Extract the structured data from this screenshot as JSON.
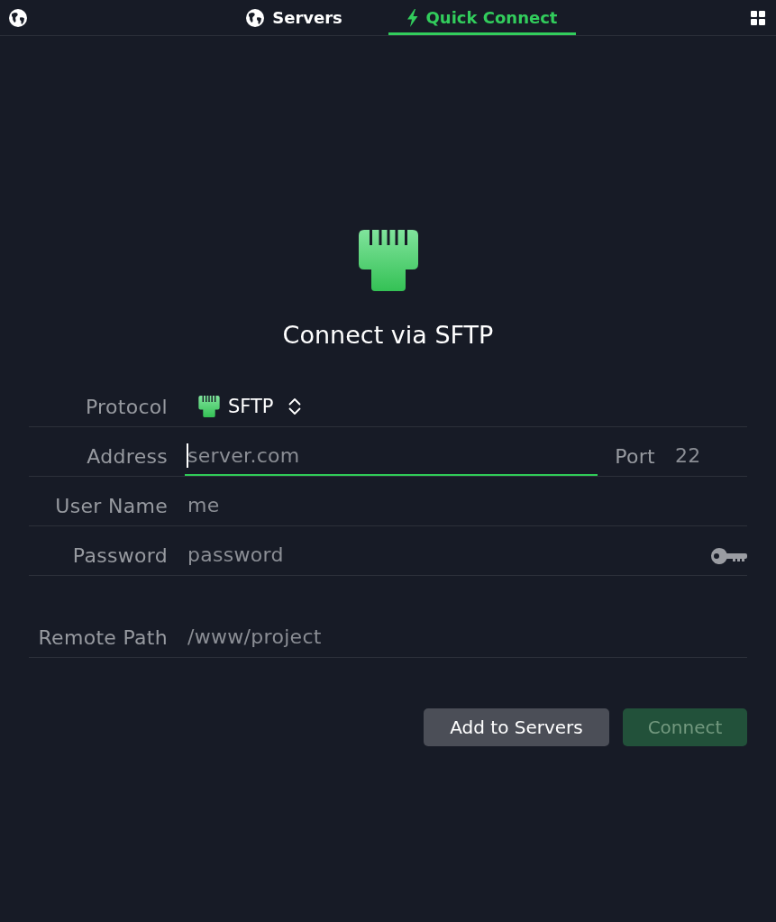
{
  "top_bar": {
    "tabs": [
      {
        "label": "Servers",
        "selected": false
      },
      {
        "label": "Quick Connect",
        "selected": true
      }
    ]
  },
  "heading": "Connect via SFTP",
  "form": {
    "rows": [
      {
        "kind": "select",
        "label": "Protocol",
        "value": "SFTP"
      },
      {
        "kind": "address",
        "label": "Address",
        "placeholder": "server.com",
        "focused": true,
        "port_label": "Port",
        "port_placeholder": "22"
      },
      {
        "kind": "text",
        "label": "User Name",
        "placeholder": "me",
        "focused": false
      },
      {
        "kind": "password",
        "label": "Password",
        "placeholder": "password",
        "focused": false
      }
    ],
    "remote_path": {
      "label": "Remote Path",
      "placeholder": "/www/project",
      "focused": false
    }
  },
  "buttons": [
    {
      "label": "Add to Servers",
      "kind": "secondary",
      "disabled": false
    },
    {
      "label": "Connect",
      "kind": "primary",
      "disabled": true
    }
  ]
}
